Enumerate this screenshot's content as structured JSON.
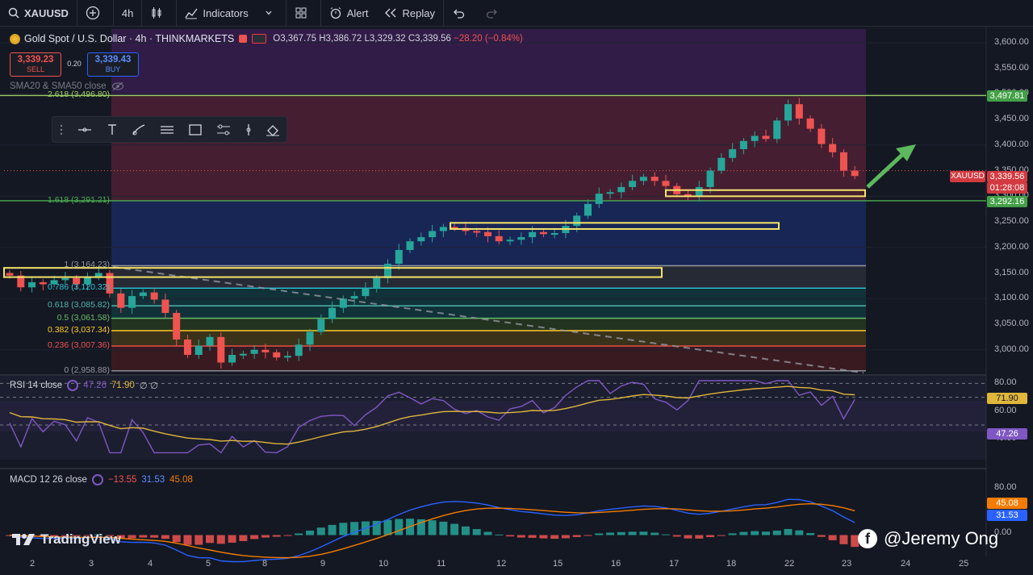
{
  "toolbar": {
    "symbol": "XAUUSD",
    "interval": "4h",
    "indicators_label": "Indicators",
    "alert_label": "Alert",
    "replay_label": "Replay"
  },
  "legend": {
    "title": "Gold Spot / U.S. Dollar · 4h · THINKMARKETS",
    "open": "O3,367.75",
    "high": "H3,386.72",
    "low": "L3,329.32",
    "close": "C3,339.56",
    "change": "−28.20 (−0.84%)"
  },
  "trade": {
    "sell_price": "3,339.23",
    "sell_label": "SELL",
    "spread": "0.20",
    "buy_price": "3,339.43",
    "buy_label": "BUY"
  },
  "sma_label": "SMA20 & SMA50 close",
  "fib_levels": [
    {
      "label": "2.618 (3,496.80)",
      "price": 3496.8,
      "color": "#9ccc65"
    },
    {
      "label": "1.618 (3,291.21)",
      "price": 3291.21,
      "color": "#4caf50"
    },
    {
      "label": "1 (3,164.23)",
      "price": 3164.23,
      "color": "#9598a1"
    },
    {
      "label": "0.786 (3,120.32)",
      "price": 3120.32,
      "color": "#26c6da"
    },
    {
      "label": "0.618 (3,085.82)",
      "price": 3085.82,
      "color": "#4db6ac"
    },
    {
      "label": "0.5 (3,061.58)",
      "price": 3061.58,
      "color": "#66bb6a"
    },
    {
      "label": "0.382 (3,037.34)",
      "price": 3037.34,
      "color": "#ffca28"
    },
    {
      "label": "0.236 (3,007.36)",
      "price": 3007.36,
      "color": "#ef5350"
    },
    {
      "label": "0 (2,958.88)",
      "price": 2958.88,
      "color": "#9598a1"
    }
  ],
  "price_axis": [
    "3,600.00",
    "3,550.00",
    "3,500.00",
    "3,450.00",
    "3,400.00",
    "3,350.00",
    "3,300.00",
    "3,250.00",
    "3,200.00",
    "3,150.00",
    "3,100.00",
    "3,050.00",
    "3,000.00"
  ],
  "price_tags": {
    "resistance": "3,497.81",
    "symbol": "XAUUSD",
    "last": "3,339.56",
    "countdown": "01:28:08",
    "support": "3,292.16"
  },
  "rsi": {
    "label": "RSI 14 close",
    "value": "47.26",
    "ma_value": "71.90",
    "extra": "∅ ∅",
    "axis": [
      "80.00",
      "60.00",
      "40.00"
    ]
  },
  "macd": {
    "label": "MACD 12 26 close",
    "hist": "−13.55",
    "macd": "31.53",
    "signal": "45.08",
    "axis": [
      "80.00",
      "0.00"
    ]
  },
  "date_axis": [
    "2",
    "3",
    "4",
    "5",
    "8",
    "9",
    "10",
    "11",
    "12",
    "15",
    "16",
    "17",
    "18",
    "22",
    "23",
    "24",
    "25"
  ],
  "watermark": "TradingView",
  "credit": "@Jeremy Ong",
  "colors": {
    "up": "#26a69a",
    "down": "#ef5350",
    "rsi": "#7e57c2",
    "ma": "#e0b63b",
    "macd": "#2962ff",
    "signal": "#f57c00"
  },
  "chart_data": {
    "type": "candlestick",
    "title": "Gold Spot / U.S. Dollar · 4h · THINKMARKETS",
    "xlabel": "",
    "ylabel": "",
    "ylim": [
      2950,
      3625
    ],
    "x": [
      "2",
      "3",
      "4",
      "5",
      "8",
      "9",
      "10",
      "11",
      "12",
      "15",
      "16",
      "17",
      "18",
      "22",
      "23",
      "24",
      "25"
    ],
    "close_path": [
      3145,
      3122,
      3132,
      3128,
      3136,
      3140,
      3128,
      3142,
      3150,
      3110,
      3082,
      3105,
      3112,
      3098,
      3072,
      3020,
      2990,
      3008,
      3025,
      2975,
      2990,
      2992,
      3000,
      2995,
      2985,
      2988,
      3010,
      3035,
      3060,
      3082,
      3100,
      3105,
      3120,
      3140,
      3168,
      3195,
      3212,
      3220,
      3232,
      3240,
      3238,
      3232,
      3230,
      3222,
      3212,
      3215,
      3220,
      3230,
      3226,
      3228,
      3242,
      3262,
      3285,
      3305,
      3308,
      3318,
      3330,
      3338,
      3330,
      3320,
      3304,
      3300,
      3318,
      3350,
      3375,
      3392,
      3408,
      3418,
      3412,
      3448,
      3480,
      3452,
      3432,
      3402,
      3386,
      3350,
      3339.56
    ],
    "rsi_ylim": [
      25,
      85
    ],
    "macd_ylim": [
      -30,
      90
    ]
  }
}
